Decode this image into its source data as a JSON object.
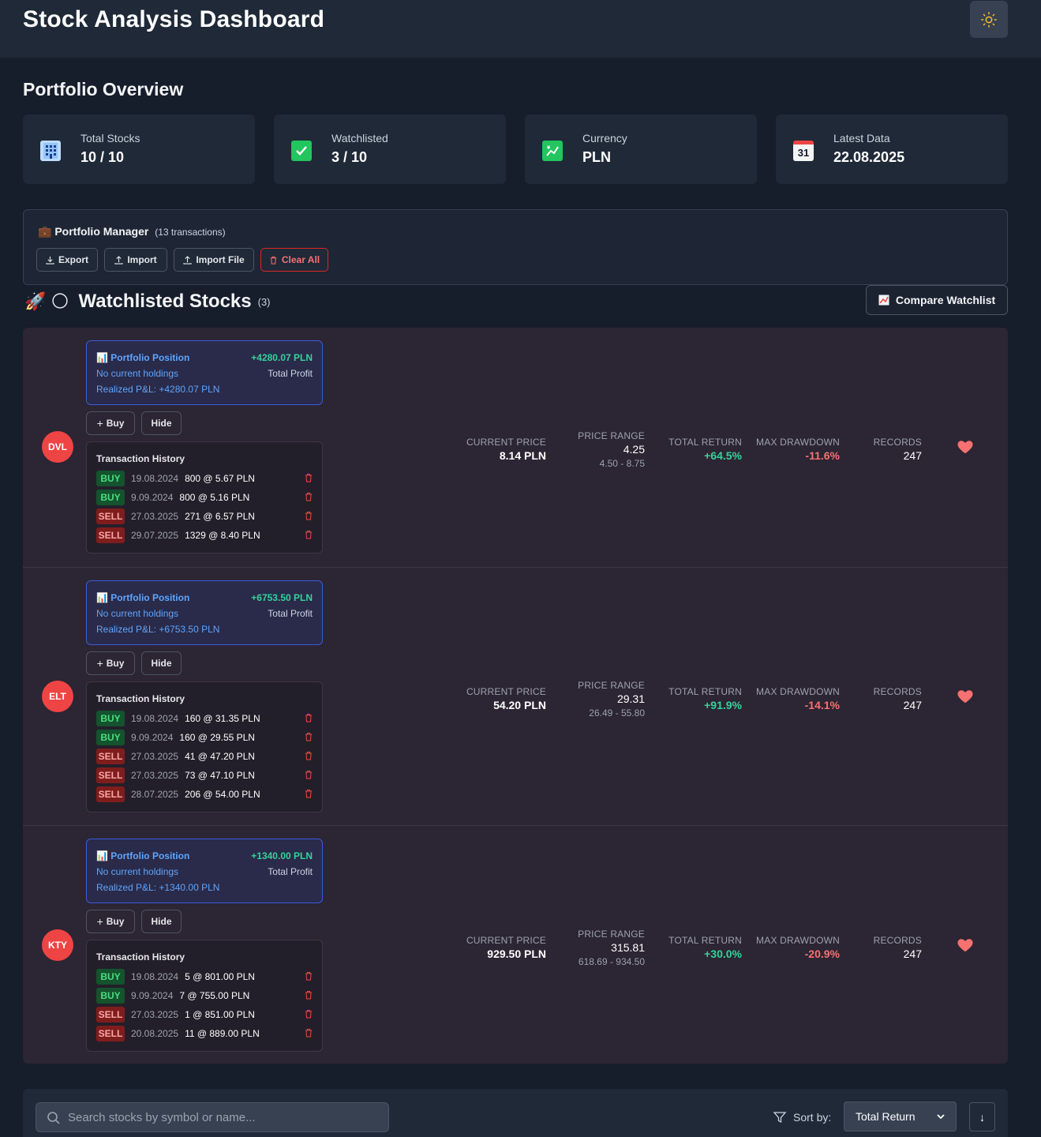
{
  "header": {
    "title": "Stock Analysis Dashboard",
    "theme_icon": "sun-icon"
  },
  "overview": {
    "title": "Portfolio Overview",
    "cards": [
      {
        "label": "Total Stocks",
        "value": "10 / 10",
        "icon": "building-icon"
      },
      {
        "label": "Watchlisted",
        "value": "3 / 10",
        "icon": "checkmark-icon"
      },
      {
        "label": "Currency",
        "value": "PLN",
        "icon": "chart-up-icon"
      },
      {
        "label": "Latest Data",
        "value": "22.08.2025",
        "icon": "calendar-icon",
        "icon_text": "31"
      }
    ]
  },
  "portfolio_manager": {
    "emoji": "💼",
    "title": "Portfolio Manager",
    "count": "(13 transactions)",
    "buttons": {
      "export": "Export",
      "import": "Import",
      "import_file": "Import File",
      "clear_all": "Clear All"
    }
  },
  "watchlist": {
    "emoji": "🚀 🌕",
    "title": "Watchlisted Stocks",
    "count": "(3)",
    "compare_label": "Compare Watchlist",
    "labels": {
      "position_title": "Portfolio Position",
      "no_holdings": "No current holdings",
      "total_profit": "Total Profit",
      "buy": "Buy",
      "hide": "Hide",
      "tx_history": "Transaction History",
      "current_price": "CURRENT PRICE",
      "price_range": "PRICE RANGE",
      "total_return": "TOTAL RETURN",
      "max_drawdown": "MAX DRAWDOWN",
      "records": "RECORDS"
    },
    "stocks": [
      {
        "symbol": "DVL",
        "profit": "+4280.07 PLN",
        "realized": "Realized P&L: +4280.07 PLN",
        "current_price": "8.14 PLN",
        "price_range": "4.25",
        "price_range_sub": "4.50 - 8.75",
        "total_return": "+64.5%",
        "max_drawdown": "-11.6%",
        "records": "247",
        "transactions": [
          {
            "type": "BUY",
            "date": "19.08.2024",
            "detail": "800 @ 5.67 PLN"
          },
          {
            "type": "BUY",
            "date": "9.09.2024",
            "detail": "800 @ 5.16 PLN"
          },
          {
            "type": "SELL",
            "date": "27.03.2025",
            "detail": "271 @ 6.57 PLN"
          },
          {
            "type": "SELL",
            "date": "29.07.2025",
            "detail": "1329 @ 8.40 PLN"
          }
        ]
      },
      {
        "symbol": "ELT",
        "profit": "+6753.50 PLN",
        "realized": "Realized P&L: +6753.50 PLN",
        "current_price": "54.20 PLN",
        "price_range": "29.31",
        "price_range_sub": "26.49 - 55.80",
        "total_return": "+91.9%",
        "max_drawdown": "-14.1%",
        "records": "247",
        "transactions": [
          {
            "type": "BUY",
            "date": "19.08.2024",
            "detail": "160 @ 31.35 PLN"
          },
          {
            "type": "BUY",
            "date": "9.09.2024",
            "detail": "160 @ 29.55 PLN"
          },
          {
            "type": "SELL",
            "date": "27.03.2025",
            "detail": "41 @ 47.20 PLN"
          },
          {
            "type": "SELL",
            "date": "27.03.2025",
            "detail": "73 @ 47.10 PLN"
          },
          {
            "type": "SELL",
            "date": "28.07.2025",
            "detail": "206 @ 54.00 PLN"
          }
        ]
      },
      {
        "symbol": "KTY",
        "profit": "+1340.00 PLN",
        "realized": "Realized P&L: +1340.00 PLN",
        "current_price": "929.50 PLN",
        "price_range": "315.81",
        "price_range_sub": "618.69 - 934.50",
        "total_return": "+30.0%",
        "max_drawdown": "-20.9%",
        "records": "247",
        "transactions": [
          {
            "type": "BUY",
            "date": "19.08.2024",
            "detail": "5 @ 801.00 PLN"
          },
          {
            "type": "BUY",
            "date": "9.09.2024",
            "detail": "7 @ 755.00 PLN"
          },
          {
            "type": "SELL",
            "date": "27.03.2025",
            "detail": "1 @ 851.00 PLN"
          },
          {
            "type": "SELL",
            "date": "20.08.2025",
            "detail": "11 @ 889.00 PLN"
          }
        ]
      }
    ]
  },
  "filter": {
    "search_placeholder": "Search stocks by symbol or name...",
    "sort_label": "Sort by:",
    "sort_value": "Total Return",
    "sort_dir": "↓"
  },
  "colors": {
    "accent_blue": "#60a5fa",
    "positive": "#34d399",
    "negative": "#f87171",
    "avatar": "#ef4444"
  }
}
